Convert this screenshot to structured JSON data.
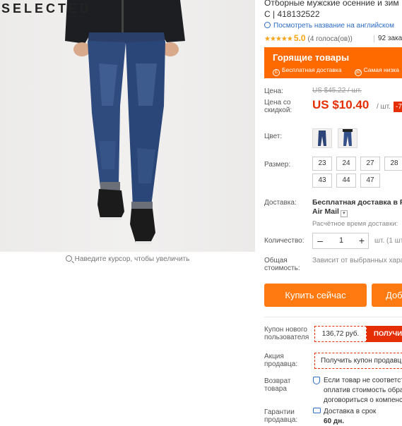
{
  "image": {
    "brand": "SELECTED",
    "zoom_hint": "Наведите курсор, чтобы увеличить"
  },
  "product": {
    "title_line1": "Отборные мужские осенние и зим",
    "title_line2": "С | 418132522",
    "translate_link": "Посмотреть название на английском",
    "rating": "5.0",
    "votes": "(4 голоса(ов))",
    "orders": "92 зака"
  },
  "hot_deals": {
    "title": "Горящие товары",
    "free_shipping": "Бесплатная доставка",
    "free_shipping_icon": "Б",
    "lowest": "Самая низка",
    "lowest_icon": "30"
  },
  "price": {
    "price_label": "Цена:",
    "old": "US $45.22 / шт.",
    "discount_label": "Цена со скидкой:",
    "new": "US $10.40",
    "per_unit": "/ шт.",
    "discount_badge": "-7"
  },
  "color": {
    "label": "Цвет:"
  },
  "size": {
    "label": "Размер:",
    "options": [
      "23",
      "24",
      "27",
      "28",
      "43",
      "44",
      "47"
    ]
  },
  "shipping": {
    "label": "Доставка:",
    "method_line1": "Бесплатная доставка в Ru",
    "method_line2": "Air Mail",
    "time": "Расчётное время доставки:"
  },
  "quantity": {
    "label": "Количество:",
    "value": "1",
    "minus": "–",
    "plus": "+",
    "unit": "шт. (1 шт"
  },
  "total": {
    "label": "Общая стоимость:",
    "value": "Зависит от выбранных хара"
  },
  "actions": {
    "buy": "Купить сейчас",
    "cart": "Доб"
  },
  "coupons": {
    "new_user_label": "Купон нового пользователя",
    "new_user_value": "136,72 руб.",
    "get_button": "ПОЛУЧИ",
    "seller_label": "Акция продавца:",
    "seller_button": "Получить купон продавц"
  },
  "returns": {
    "label": "Возврат товара",
    "line1": "Если товар не соответст",
    "line2": "оплатив стоимость обра",
    "line3": "договориться о компенс"
  },
  "guarantee": {
    "label": "Гарантии продавца:",
    "line1": "Доставка в срок",
    "line2": "60 дн."
  },
  "colors": {
    "accent": "#ff6a00",
    "price": "#e62e04",
    "link": "#2d6dc4",
    "button": "#ff7a11"
  }
}
